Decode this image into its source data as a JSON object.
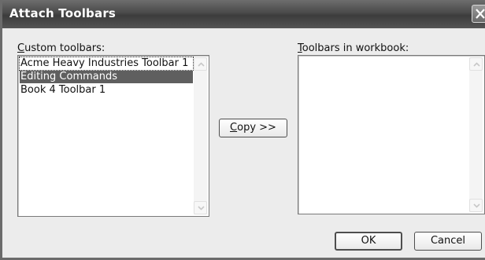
{
  "dialog": {
    "title": "Attach Toolbars",
    "close_icon": "close-icon"
  },
  "custom_toolbars": {
    "label_mnemonic": "C",
    "label_rest": "ustom toolbars:",
    "items": [
      {
        "label": "Acme Heavy Industries Toolbar 1",
        "selected": false
      },
      {
        "label": "Editing Commands",
        "selected": true
      },
      {
        "label": "Book 4 Toolbar 1",
        "selected": false
      }
    ]
  },
  "copy_button": {
    "mnemonic": "C",
    "rest": "opy >>"
  },
  "workbook_toolbars": {
    "label_mnemonic": "T",
    "label_rest": "oolbars in workbook:",
    "items": []
  },
  "buttons": {
    "ok": "OK",
    "cancel": "Cancel"
  }
}
